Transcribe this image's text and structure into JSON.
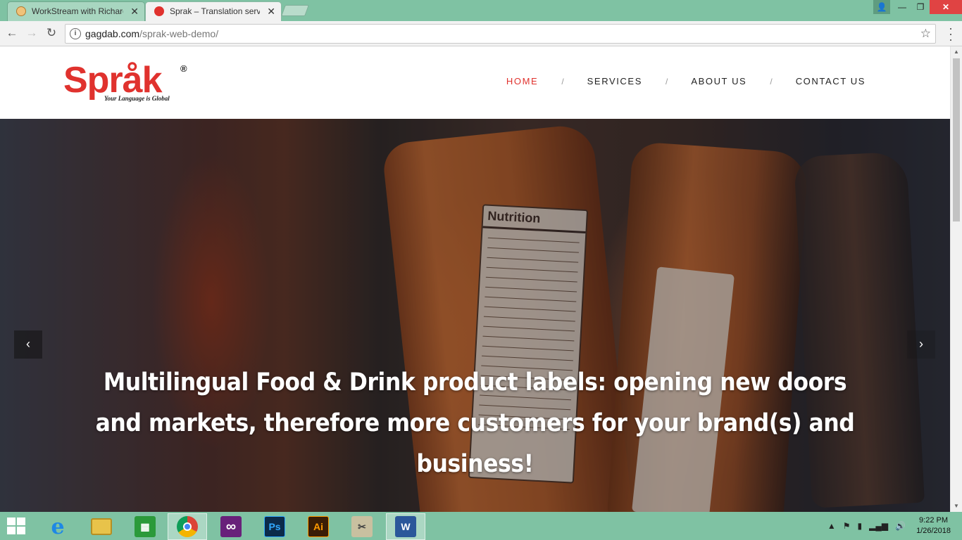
{
  "browser": {
    "tabs": [
      {
        "title": "WorkStream with Richard",
        "active": false
      },
      {
        "title": "Sprak – Translation services",
        "active": true
      }
    ],
    "url_domain": "gagdab.com",
    "url_path": "/sprak-web-demo/"
  },
  "site": {
    "logo_text": "Språk",
    "logo_reg": "®",
    "logo_tagline": "Your Language is Global",
    "nav": [
      {
        "label": "HOME",
        "active": true
      },
      {
        "label": "SERVICES",
        "active": false
      },
      {
        "label": "ABOUT US",
        "active": false
      },
      {
        "label": "CONTACT US",
        "active": false
      }
    ],
    "nav_separator": "/",
    "hero": {
      "line1": "Multilingual Food & Drink product labels: opening new doors",
      "line2": "and markets, therefore more customers for your brand(s) and business!",
      "label_title": "Nutrition"
    }
  },
  "taskbar": {
    "apps": [
      {
        "name": "internet-explorer",
        "glyph": "e",
        "color": "#1e88e5"
      },
      {
        "name": "file-explorer",
        "glyph": "",
        "color": "#e8c34a"
      },
      {
        "name": "windows-store",
        "glyph": "",
        "color": "#2b9a3a"
      },
      {
        "name": "chrome",
        "glyph": "",
        "color": "#ffffff"
      },
      {
        "name": "visual-studio",
        "glyph": "∞",
        "color": "#68217a"
      },
      {
        "name": "photoshop",
        "glyph": "Ps",
        "color": "#0b2a4a"
      },
      {
        "name": "illustrator",
        "glyph": "Ai",
        "color": "#3a1d06"
      },
      {
        "name": "tools",
        "glyph": "",
        "color": "#c9c0a0"
      },
      {
        "name": "word",
        "glyph": "W",
        "color": "#2b579a"
      }
    ],
    "time": "9:22 PM",
    "date": "1/26/2018"
  },
  "colors": {
    "brand_red": "#e0322e",
    "chrome_green": "#7fc2a3"
  }
}
